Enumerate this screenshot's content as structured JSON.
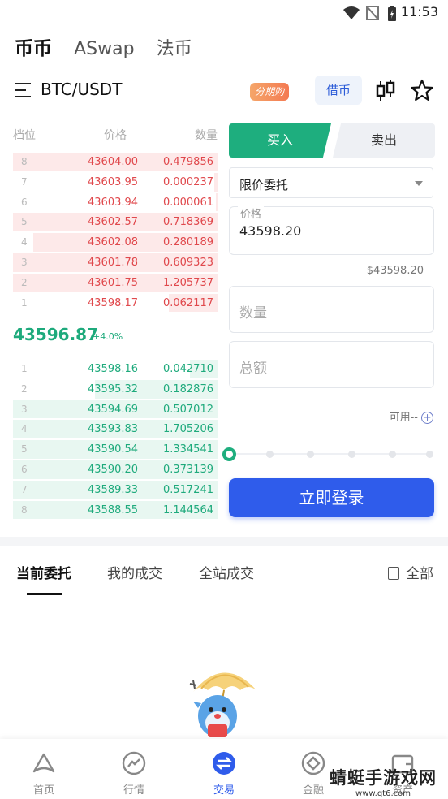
{
  "statusbar": {
    "time": "11:53"
  },
  "top_tabs": [
    "币币",
    "ASwap",
    "法币"
  ],
  "header": {
    "pair": "BTC/USDT",
    "fenqi_badge": "分期购",
    "borrow_label": "借币"
  },
  "orderbook": {
    "headers": {
      "level": "档位",
      "price": "价格",
      "qty": "数量"
    },
    "asks": [
      {
        "level": "8",
        "price": "43604.00",
        "qty": "0.479856",
        "depth": 1.0
      },
      {
        "level": "7",
        "price": "43603.95",
        "qty": "0.000237",
        "depth": 0.02
      },
      {
        "level": "6",
        "price": "43603.94",
        "qty": "0.000061",
        "depth": 0.01
      },
      {
        "level": "5",
        "price": "43602.57",
        "qty": "0.718369",
        "depth": 1.0
      },
      {
        "level": "4",
        "price": "43602.08",
        "qty": "0.280189",
        "depth": 0.9
      },
      {
        "level": "3",
        "price": "43601.78",
        "qty": "0.609323",
        "depth": 1.0
      },
      {
        "level": "2",
        "price": "43601.75",
        "qty": "1.205737",
        "depth": 1.0
      },
      {
        "level": "1",
        "price": "43598.17",
        "qty": "0.062117",
        "depth": 0.24
      }
    ],
    "last_price": "43596.87",
    "change": "+4.0%",
    "bids": [
      {
        "level": "1",
        "price": "43598.16",
        "qty": "0.042710",
        "depth": 0.14
      },
      {
        "level": "2",
        "price": "43595.32",
        "qty": "0.182876",
        "depth": 0.6
      },
      {
        "level": "3",
        "price": "43594.69",
        "qty": "0.507012",
        "depth": 1.0
      },
      {
        "level": "4",
        "price": "43593.83",
        "qty": "1.705206",
        "depth": 1.0
      },
      {
        "level": "5",
        "price": "43590.54",
        "qty": "1.334541",
        "depth": 1.0
      },
      {
        "level": "6",
        "price": "43590.20",
        "qty": "0.373139",
        "depth": 1.0
      },
      {
        "level": "7",
        "price": "43589.33",
        "qty": "0.517241",
        "depth": 1.0
      },
      {
        "level": "8",
        "price": "43588.55",
        "qty": "1.144564",
        "depth": 1.0
      }
    ]
  },
  "trade_form": {
    "buy_label": "买入",
    "sell_label": "卖出",
    "order_type": "限价委托",
    "price_label": "价格",
    "price_value": "43598.20",
    "usd_value": "$43598.20",
    "qty_placeholder": "数量",
    "total_placeholder": "总额",
    "available": "可用--",
    "login_button": "立即登录"
  },
  "order_tabs": {
    "current": "当前委托",
    "my_trades": "我的成交",
    "all_trades": "全站成交",
    "all_label": "全部"
  },
  "bottom_nav": [
    "首页",
    "行情",
    "交易",
    "金融",
    "资产"
  ],
  "watermark": {
    "line1": "蜻蜓手游戏网",
    "line2": "www.qt6.com"
  },
  "colors": {
    "buy": "#1eae7e",
    "sell": "#e0484c",
    "primary": "#2f5ceb"
  }
}
